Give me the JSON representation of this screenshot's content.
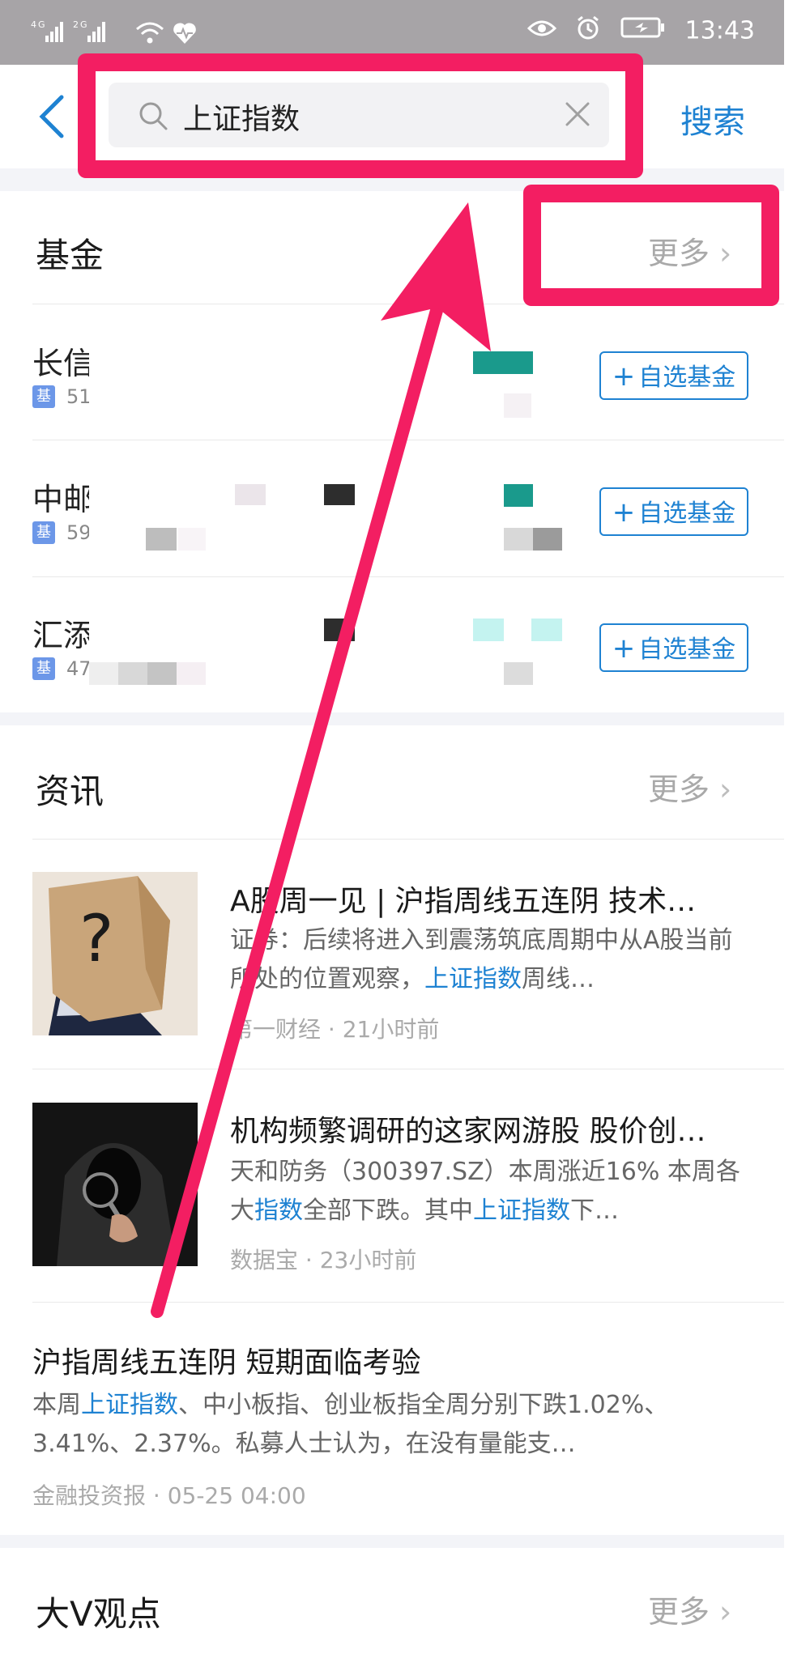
{
  "status_bar": {
    "signal": "4G .ıl 2G .ıl",
    "time": "13:43"
  },
  "header": {
    "search_query": "上证指数",
    "search_button": "搜索"
  },
  "funds": {
    "title": "基金",
    "more": "更多",
    "items": [
      {
        "name": "长信",
        "tag": "基",
        "code": "51",
        "add": "自选基金"
      },
      {
        "name": "中邮",
        "tag": "基",
        "code": "59",
        "add": "自选基金"
      },
      {
        "name": "汇添",
        "tag": "基",
        "code": "47",
        "add": "自选基金"
      }
    ]
  },
  "news": {
    "title": "资讯",
    "more": "更多",
    "items": [
      {
        "title": "A股周一见 | 沪指周线五连阴 技术…",
        "summary_parts": [
          "证券：后续将进入到震荡筑底周期中从A股当前所处的位置观察，",
          "上证指数",
          "周线…"
        ],
        "meta": "第一财经 · 21小时前"
      },
      {
        "title": "机构频繁调研的这家网游股 股价创…",
        "summary_parts": [
          "天和防务（300397.SZ）本周涨近16% 本周各大",
          "指数",
          "全部下跌。其中",
          "上证指数",
          "下…"
        ],
        "meta": "数据宝 · 23小时前"
      },
      {
        "title": "沪指周线五连阴 短期面临考验",
        "summary_parts": [
          "本周",
          "上证指数",
          "、中小板指、创业板指全周分别下跌1.02%、3.41%、2.37%。私募人士认为，在没有量能支…"
        ],
        "meta": "金融投资报 · 05-25 04:00"
      }
    ]
  },
  "dav": {
    "title": "大V观点",
    "more": "更多"
  },
  "colors": {
    "accent": "#1e82d2",
    "annotation": "#f31e62",
    "fund_tag": "#6c97e8"
  }
}
